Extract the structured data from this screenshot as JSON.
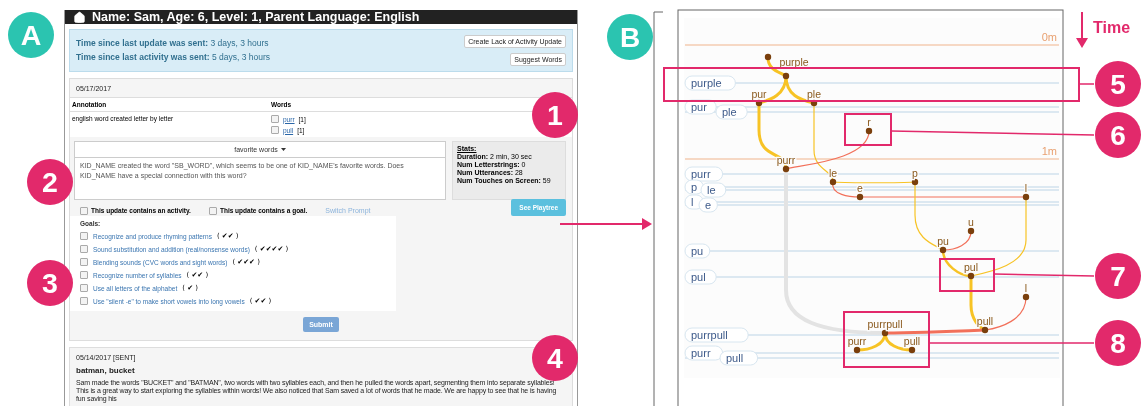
{
  "badges": {
    "left": "A",
    "right": "B"
  },
  "profile_header": {
    "title": "Name: Sam, Age: 6, Level: 1, Parent Language: English"
  },
  "status": {
    "rows": [
      {
        "label": "Time since last update was sent:",
        "value": "3 days, 3 hours"
      },
      {
        "label": "Time since last activity was sent:",
        "value": "5 days, 3 hours"
      }
    ],
    "buttons": [
      "Create Lack of Activity Update",
      "Suggest Words"
    ]
  },
  "current_entry": {
    "date": "05/17/2017",
    "columns": [
      "Annotation",
      "Words"
    ],
    "annotation": "english word created letter by letter",
    "words": [
      {
        "word": "purr",
        "count": "[1]",
        "checked": false
      },
      {
        "word": "pull",
        "count": "[1]",
        "checked": false
      }
    ],
    "prompt": {
      "menu": "favorite words",
      "text": "KID_NAME created the word \"SB_WORD\", which seems to be one of KID_NAME's favorite words. Does KID_NAME have a special connection with this word?"
    },
    "stats": {
      "title": "Stats:",
      "items": [
        {
          "label": "Duration:",
          "value": "2 min, 30 sec"
        },
        {
          "label": "Num Letterstrings:",
          "value": "0"
        },
        {
          "label": "Num Utterances:",
          "value": "28"
        },
        {
          "label": "Num Touches on Screen:",
          "value": "59"
        }
      ]
    },
    "options": [
      {
        "label": "This update contains an activity.",
        "checked": false
      },
      {
        "label": "This update contains a goal.",
        "checked": false
      }
    ],
    "switch_link": "Switch Prompt",
    "playtree_button": "See Playtree",
    "goals_title": "Goals:",
    "goals": [
      {
        "label": "Recognize and produce rhyming patterns",
        "progress": "( ✔✔ )",
        "checked": false
      },
      {
        "label": "Sound substitution and addition (real/nonsense words)",
        "progress": "( ✔✔✔✔ )",
        "checked": false
      },
      {
        "label": "Blending sounds (CVC words and sight words)",
        "progress": "( ✔✔✔ )",
        "checked": false
      },
      {
        "label": "Recognize number of syllables",
        "progress": "( ✔✔ )",
        "checked": false
      },
      {
        "label": "Use all letters of the alphabet",
        "progress": "( ✔ )",
        "checked": false
      },
      {
        "label": "Use \"silent -e\" to make short vowels into long vowels",
        "progress": "( ✔✔ )",
        "checked": false
      }
    ],
    "submit": "Submit"
  },
  "past_entry": {
    "date": "05/14/2017 [SENT]",
    "title": "batman, bucket",
    "body": "Sam made the words \"BUCKET\" and \"BATMAN\", two words with two syllables each, and then he pulled the words apart, segmenting them into separate syllables! This is a great way to start exploring the syllables within words! We also noticed that Sam saved a lot of words that he made. We are happy to see that he is having fun saving his"
  },
  "callouts": [
    "1",
    "2",
    "3",
    "4"
  ],
  "playtree": {
    "time_label": "Time",
    "time_marks": [
      "0m",
      "1m"
    ],
    "lanes": [
      "purple",
      "pur",
      "ple",
      "purr",
      "p",
      "le",
      "l",
      "e",
      "pu",
      "pul",
      "purrpull",
      "purr",
      "pull"
    ],
    "nodes": [
      "purple",
      "pur",
      "ple",
      "r",
      "purr",
      "le",
      "p",
      "e",
      "l",
      "u",
      "pu",
      "pul",
      "l",
      "pull",
      "purrpull",
      "purr",
      "pull"
    ],
    "callouts": [
      "5",
      "6",
      "7",
      "8"
    ]
  }
}
